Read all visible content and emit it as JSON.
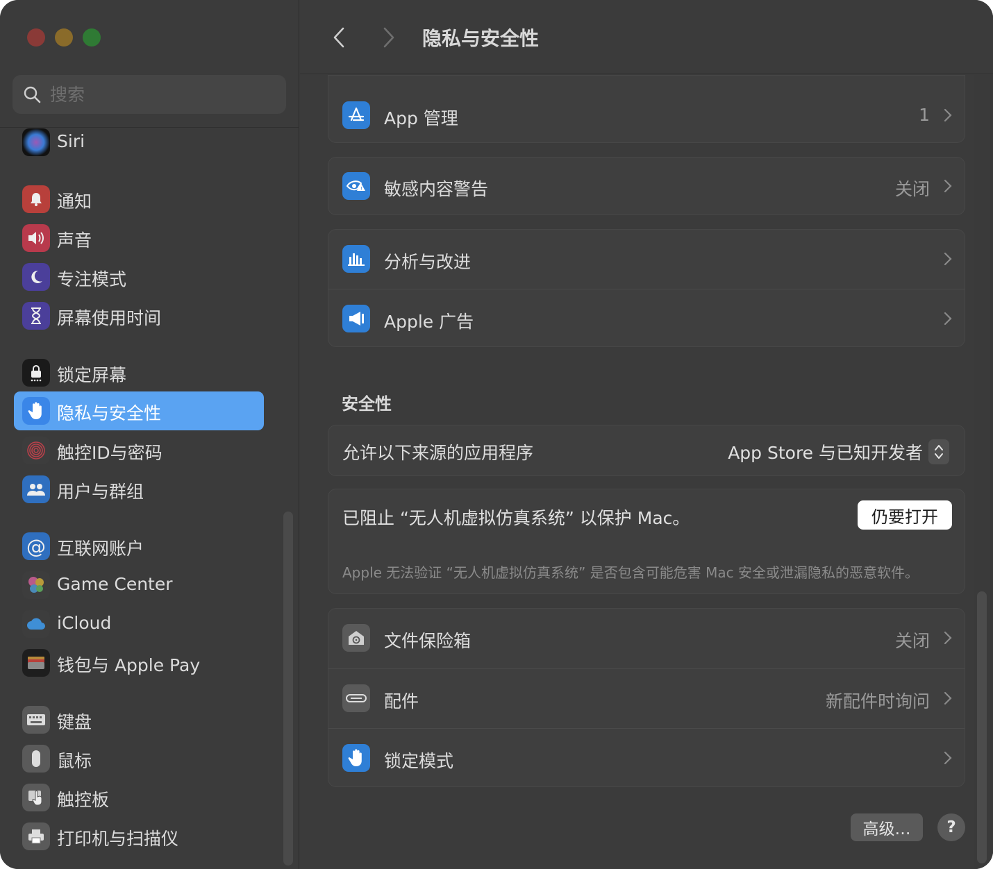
{
  "window": {
    "title": "隐私与安全性"
  },
  "sidebar": {
    "search_placeholder": "搜索",
    "items": [
      {
        "label": "Siri",
        "icon": "siri-icon"
      },
      {
        "label": "通知",
        "icon": "bell-icon"
      },
      {
        "label": "声音",
        "icon": "speaker-icon"
      },
      {
        "label": "专注模式",
        "icon": "moon-icon"
      },
      {
        "label": "屏幕使用时间",
        "icon": "hourglass-icon"
      },
      {
        "label": "锁定屏幕",
        "icon": "lock-icon"
      },
      {
        "label": "隐私与安全性",
        "icon": "hand-icon",
        "selected": true
      },
      {
        "label": "触控ID与密码",
        "icon": "fingerprint-icon"
      },
      {
        "label": "用户与群组",
        "icon": "users-icon"
      },
      {
        "label": "互联网账户",
        "icon": "at-icon"
      },
      {
        "label": "Game Center",
        "icon": "game-center-icon"
      },
      {
        "label": "iCloud",
        "icon": "cloud-icon"
      },
      {
        "label": "钱包与 Apple Pay",
        "icon": "wallet-icon"
      },
      {
        "label": "键盘",
        "icon": "keyboard-icon"
      },
      {
        "label": "鼠标",
        "icon": "mouse-icon"
      },
      {
        "label": "触控板",
        "icon": "trackpad-icon"
      },
      {
        "label": "打印机与扫描仪",
        "icon": "printer-icon"
      }
    ]
  },
  "main": {
    "rows_top": [
      {
        "label": "App 管理",
        "value": "1",
        "icon": "app-store-icon"
      },
      {
        "label": "敏感内容警告",
        "value": "关闭",
        "icon": "eye-warning-icon"
      },
      {
        "label": "分析与改进",
        "value": "",
        "icon": "chart-icon"
      },
      {
        "label": "Apple 广告",
        "value": "",
        "icon": "megaphone-icon"
      }
    ],
    "security": {
      "title": "安全性",
      "allow_label": "允许以下来源的应用程序",
      "allow_value": "App Store 与已知开发者",
      "blocked_text": "已阻止 “无人机虚拟仿真系统” 以保护 Mac。",
      "open_anyway": "仍要打开",
      "blocked_desc": "Apple 无法验证 “无人机虚拟仿真系统” 是否包含可能危害 Mac 安全或泄漏隐私的恶意软件。"
    },
    "rows_bottom": [
      {
        "label": "文件保险箱",
        "value": "关闭",
        "icon": "vault-icon"
      },
      {
        "label": "配件",
        "value": "新配件时询问",
        "icon": "accessory-icon"
      },
      {
        "label": "锁定模式",
        "value": "",
        "icon": "hand-icon"
      }
    ],
    "advanced_button": "高级…",
    "help_button": "?"
  },
  "colors": {
    "accent": "#5aa3f2",
    "window_bg": "#3b3b3b"
  }
}
